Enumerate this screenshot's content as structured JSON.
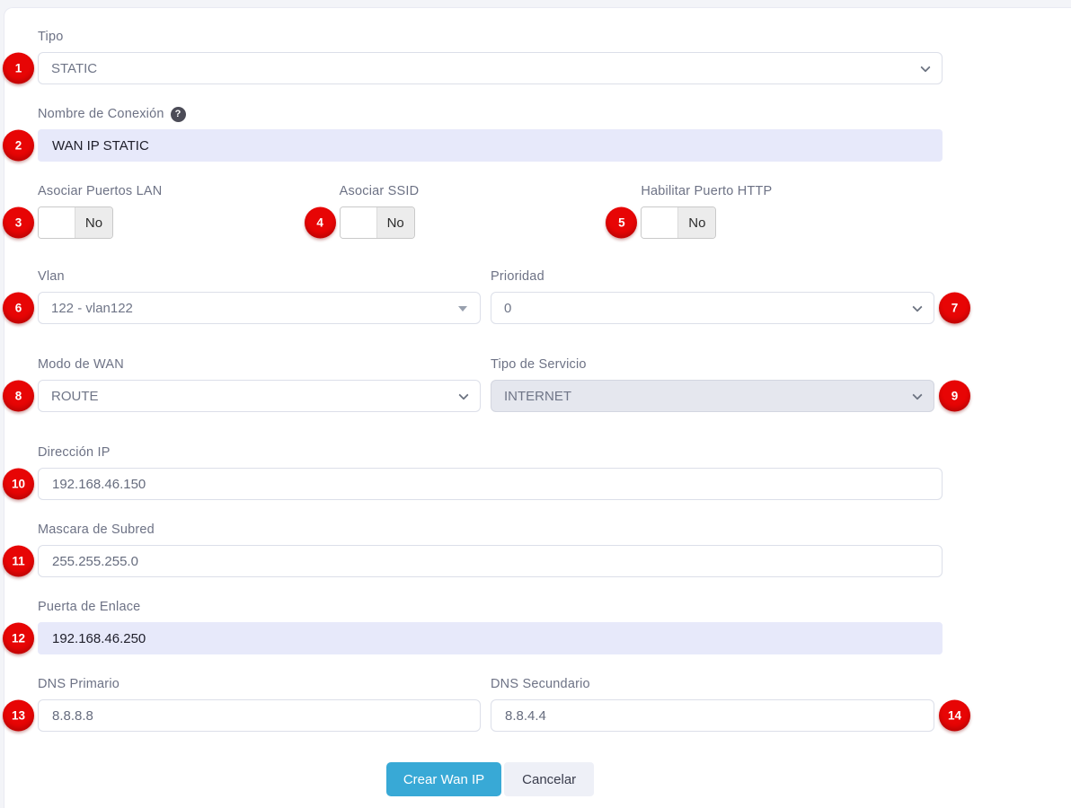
{
  "colors": {
    "badge_red": "#e70505",
    "primary_button": "#38a9d6",
    "lavender_input_bg": "#e7e9fa",
    "disabled_select_bg": "#e5e7ee"
  },
  "form": {
    "fields": {
      "tipo": {
        "label": "Tipo",
        "value": "STATIC",
        "badge": "1"
      },
      "nombre": {
        "label": "Nombre de Conexión",
        "help_icon": "?",
        "value": "WAN IP STATIC",
        "badge": "2"
      },
      "asociar_puertos_lan": {
        "label": "Asociar Puertos LAN",
        "value": "No",
        "badge": "3"
      },
      "asociar_ssid": {
        "label": "Asociar SSID",
        "value": "No",
        "badge": "4"
      },
      "habilitar_puerto_http": {
        "label": "Habilitar Puerto HTTP",
        "value": "No",
        "badge": "5"
      },
      "vlan": {
        "label": "Vlan",
        "value": "122 - vlan122",
        "badge": "6"
      },
      "prioridad": {
        "label": "Prioridad",
        "value": "0",
        "badge": "7"
      },
      "modo_wan": {
        "label": "Modo de WAN",
        "value": "ROUTE",
        "badge": "8"
      },
      "tipo_servicio": {
        "label": "Tipo de Servicio",
        "value": "INTERNET",
        "badge": "9",
        "disabled": "true"
      },
      "direccion_ip": {
        "label": "Dirección IP",
        "value": "192.168.46.150",
        "badge": "10"
      },
      "mascara": {
        "label": "Mascara de Subred",
        "value": "255.255.255.0",
        "badge": "11"
      },
      "puerta": {
        "label": "Puerta de Enlace",
        "value": "192.168.46.250",
        "badge": "12"
      },
      "dns_primario": {
        "label": "DNS Primario",
        "value": "8.8.8.8",
        "badge": "13"
      },
      "dns_secundario": {
        "label": "DNS Secundario",
        "value": "8.8.4.4",
        "badge": "14"
      }
    },
    "buttons": {
      "submit": "Crear Wan IP",
      "cancel": "Cancelar"
    }
  }
}
